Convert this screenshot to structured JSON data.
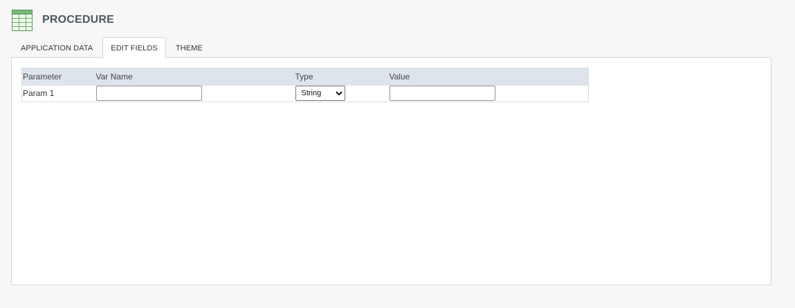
{
  "header": {
    "title": "PROCEDURE",
    "icon": "spreadsheet-icon"
  },
  "tabs": [
    {
      "label": "APPLICATION DATA",
      "active": false
    },
    {
      "label": "EDIT FIELDS",
      "active": true
    },
    {
      "label": "THEME",
      "active": false
    }
  ],
  "table": {
    "headers": [
      "Parameter",
      "Var Name",
      "Type",
      "Value"
    ],
    "rows": [
      {
        "parameter": "Param 1",
        "var_name": "",
        "type": "String",
        "value": ""
      }
    ]
  },
  "colors": {
    "background": "#f7f7f8",
    "header_row": "#dde4ec",
    "icon_green": "#4c9a4f"
  }
}
